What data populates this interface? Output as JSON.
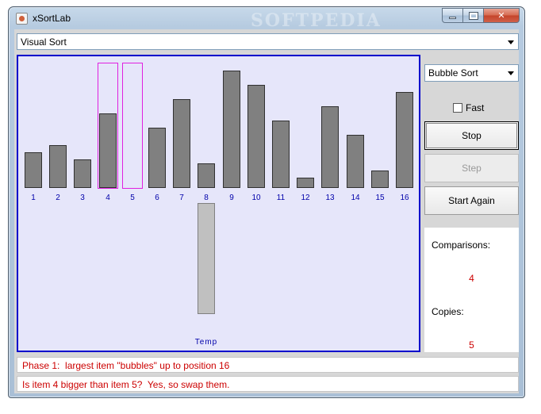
{
  "window": {
    "title": "xSortLab",
    "watermark": "SOFTPEDIA",
    "close_glyph": "✕"
  },
  "mode_select": {
    "value": "Visual Sort"
  },
  "algorithm_select": {
    "value": "Bubble Sort"
  },
  "fast": {
    "label": "Fast",
    "checked": false
  },
  "buttons": {
    "stop": "Stop",
    "step": "Step",
    "start_again": "Start Again"
  },
  "stats": {
    "comparisons_label": "Comparisons:",
    "comparisons_value": "4",
    "copies_label": "Copies:",
    "copies_value": "5"
  },
  "visual": {
    "indices": [
      "1",
      "2",
      "3",
      "4",
      "5",
      "6",
      "7",
      "8",
      "9",
      "10",
      "11",
      "12",
      "13",
      "14",
      "15",
      "16"
    ],
    "bar_values": [
      5,
      6,
      4,
      10.5,
      0,
      8.5,
      12.5,
      3.5,
      16.5,
      14.5,
      9.5,
      1.5,
      11.5,
      7.5,
      2.5,
      13.5
    ],
    "max_value": 16.5,
    "highlighted_positions": [
      4,
      5
    ],
    "temp_value": 15.5,
    "temp_label": "Temp"
  },
  "messages": {
    "phase": "Phase 1:  largest item \"bubbles\" up to position 16",
    "status": "Is item 4 bigger than item 5?  Yes, so swap them."
  },
  "colors": {
    "panel_background": "#e6e6fa",
    "panel_border": "#0000cc",
    "bar": "#808080",
    "highlight": "#e020e0",
    "index_text": "#0000aa",
    "stat_value": "#cc0000"
  }
}
